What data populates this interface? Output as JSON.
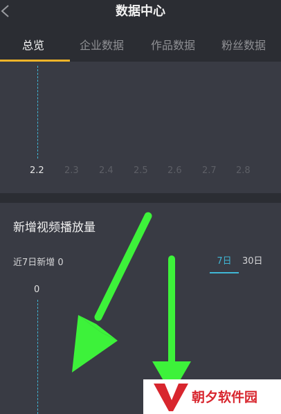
{
  "header": {
    "title": "数据中心",
    "back_icon": "chevron-left-icon"
  },
  "tabs": [
    {
      "label": "总览",
      "active": true
    },
    {
      "label": "企业数据",
      "active": false
    },
    {
      "label": "作品数据",
      "active": false
    },
    {
      "label": "粉丝数据",
      "active": false
    }
  ],
  "overview_chart": {
    "x_ticks": [
      "2.2",
      "2.3",
      "2.4",
      "2.5",
      "2.6",
      "2.7",
      "2.8"
    ],
    "selected": "2.2"
  },
  "video_plays": {
    "title": "新增视频播放量",
    "subtext": "近7日新增 0",
    "periods": [
      {
        "label": "7日",
        "active": true
      },
      {
        "label": "30日",
        "active": false
      }
    ],
    "y_label": "0"
  },
  "colors": {
    "accent_tab": "#f0b429",
    "accent_blue": "#40b7d6",
    "annotation_arrow": "#3df23a",
    "watermark_red": "#d8262e"
  },
  "watermark": {
    "text": "朝夕软件园"
  }
}
